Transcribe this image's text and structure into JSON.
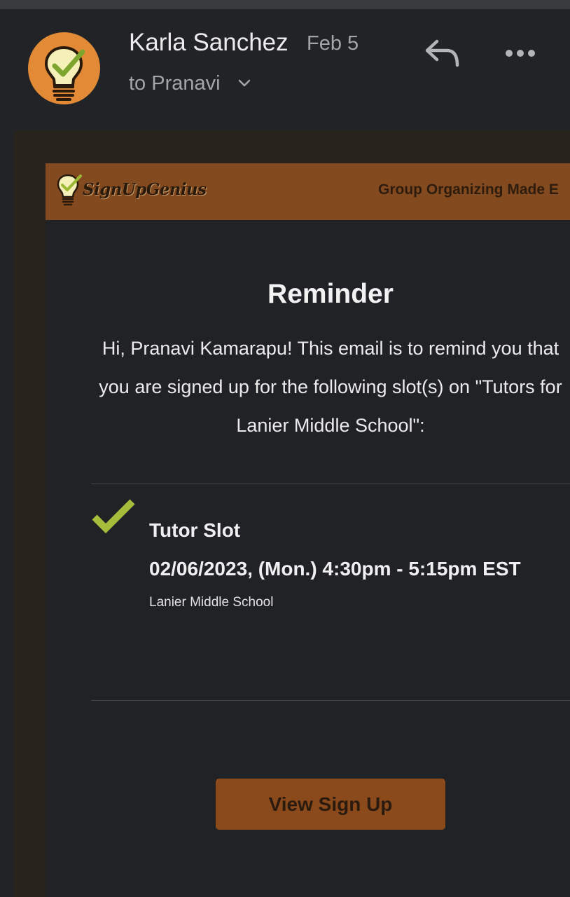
{
  "header": {
    "sender": "Karla Sanchez",
    "date": "Feb 5",
    "recipient": "to Pranavi",
    "icons": [
      "lightbulb-check-avatar",
      "chevron-down-icon",
      "reply-icon",
      "more-options-icon"
    ]
  },
  "email": {
    "brand": "SignUpGenius",
    "tagline": "Group Organizing Made E",
    "title": "Reminder",
    "intro": "Hi, Pranavi Kamarapu! This email is to remind you that you are signed up for the following slot(s) on \"Tutors for Lanier Middle School\":",
    "slot": {
      "title": "Tutor Slot",
      "time": "02/06/2023, (Mon.) 4:30pm - 5:15pm EST",
      "location": "Lanier Middle School"
    },
    "button_label": "View Sign Up"
  },
  "colors": {
    "background": "#222326",
    "banner": "#834a1f",
    "button": "#8b4a1c",
    "avatar": "#e38a36",
    "check": "#a6bd3c"
  }
}
